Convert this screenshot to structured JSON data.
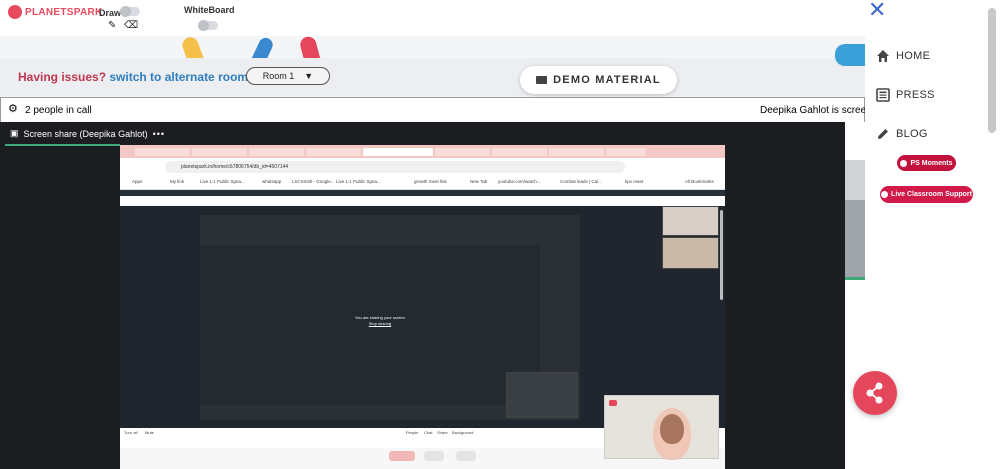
{
  "header": {
    "logo_text": "PLANETSPARK",
    "draw_label": "Draw",
    "whiteboard_label": "WhiteBoard"
  },
  "issues": {
    "question": "Having issues?",
    "link": "switch to alternate room",
    "room_value": "Room 1"
  },
  "demo_material_label": "DEMO MATERIAL",
  "call": {
    "people_count": "2 people in call",
    "sharing_status": "Deepika Gahlot is screen sharing",
    "share_title": "Screen share (Deepika Gahlot)",
    "more_label": "•••"
  },
  "inner_browser": {
    "url": "planetspark.in/home/c67806754/db_id=4507144",
    "bookmarks": [
      "Apps",
      "My link",
      "Live 1:1 Public Spea...",
      "whatsapp",
      "LSCSmith - Google...",
      "Live 1:1 Public Spea...",
      "growth meet link",
      "New Tab",
      "youtube.com/watch...",
      "Combat leads | Cal...",
      "kpx meet"
    ],
    "all_bookmarks": "All Bookmarks",
    "stop_message": "You are sharing your screen",
    "stop_link": "Stop sharing",
    "toolbar": [
      "Turn off",
      "Mute",
      "People",
      "Chat",
      "Share",
      "Background"
    ]
  },
  "nav": {
    "items": [
      {
        "label": "HOME",
        "icon": "home-icon"
      },
      {
        "label": "PRESS",
        "icon": "newspaper-icon"
      },
      {
        "label": "BLOG",
        "icon": "pencil-icon"
      }
    ],
    "ps_moments": "PS Moments",
    "live_support": "Live Classroom Support"
  },
  "colors": {
    "brand_red": "#e4475c",
    "link_blue": "#2f7fbf",
    "pill_red": "#c2133f"
  }
}
